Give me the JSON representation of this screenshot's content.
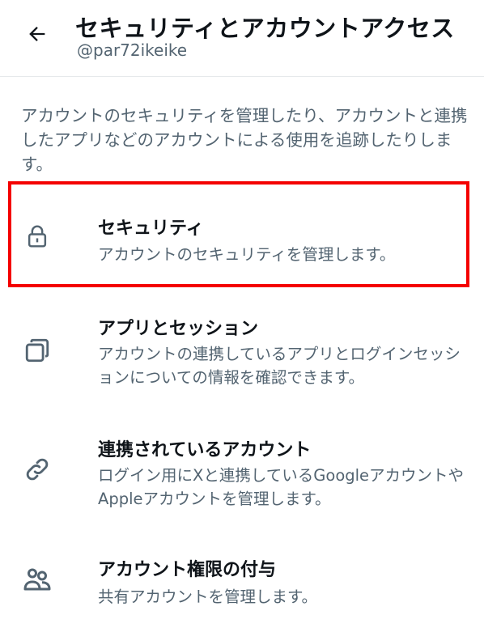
{
  "header": {
    "title": "セキュリティとアカウントアクセス",
    "handle": "@par72ikeike"
  },
  "description": "アカウントのセキュリティを管理したり、アカウントと連携したアプリなどのアカウントによる使用を追跡したりします。",
  "items": [
    {
      "icon": "lock-icon",
      "title": "セキュリティ",
      "desc": "アカウントのセキュリティを管理します。"
    },
    {
      "icon": "apps-icon",
      "title": "アプリとセッション",
      "desc": "アカウントの連携しているアプリとログインセッションについての情報を確認できます。"
    },
    {
      "icon": "link-icon",
      "title": "連携されているアカウント",
      "desc": "ログイン用にXと連携しているGoogleアカウントやAppleアカウントを管理します。"
    },
    {
      "icon": "people-icon",
      "title": "アカウント権限の付与",
      "desc": "共有アカウントを管理します。"
    }
  ],
  "colors": {
    "text": "#0f1419",
    "secondary": "#536471",
    "highlight": "#f40000"
  }
}
